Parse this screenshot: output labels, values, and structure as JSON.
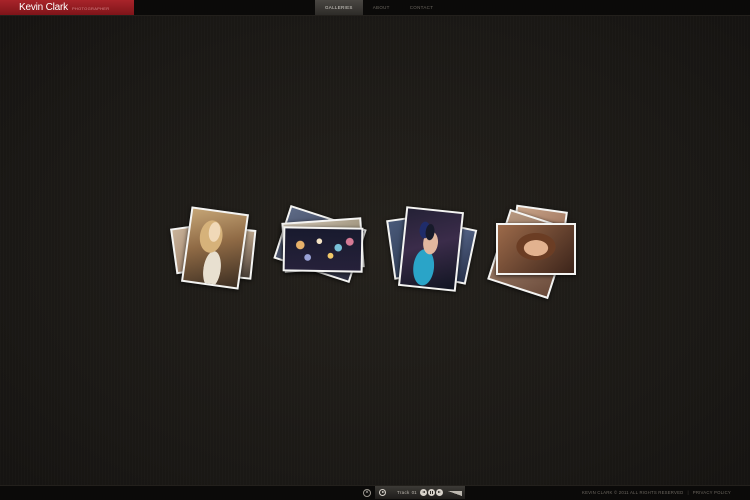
{
  "brand": {
    "name": "Kevin Clark",
    "tagline": "Photographer"
  },
  "nav": {
    "items": [
      {
        "label": "Galleries",
        "active": true
      },
      {
        "label": "About",
        "active": false
      },
      {
        "label": "Contact",
        "active": false
      }
    ]
  },
  "galleries": [
    {
      "subject": "blonde woman portrait"
    },
    {
      "subject": "bokeh lights scene"
    },
    {
      "subject": "woman in sunglasses"
    },
    {
      "subject": "brunette woman portrait"
    }
  ],
  "player": {
    "track_label": "Track",
    "track_number": "01"
  },
  "footer": {
    "copyright": "Kevin Clark © 2011 All rights reserved",
    "privacy_label": "Privacy Policy"
  },
  "colors": {
    "brand_red": "#a8242a",
    "background": "#1c1a17"
  }
}
